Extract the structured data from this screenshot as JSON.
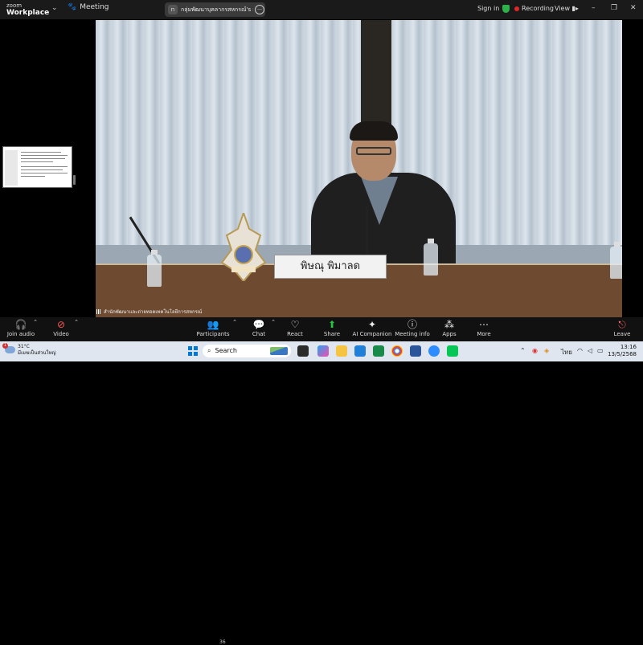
{
  "app": {
    "brand_line1": "zoom",
    "brand_line2": "Workplace",
    "meeting_label": "Meeting"
  },
  "share_pill": {
    "initial": "n",
    "text": "กลุ่มพัฒนาบุคลากรสหกรณ์'s screen"
  },
  "topbar": {
    "sign_in": "Sign in",
    "recording": "Recording",
    "view": "View",
    "min": "–",
    "restore": "❐",
    "close": "✕"
  },
  "video": {
    "nameplate": "พิษณุ พิมาลด",
    "watermark": "สำนักพัฒนาและถ่ายทอดเทคโนโลยีการสหกรณ์"
  },
  "toolbar": {
    "join_audio": "Join audio",
    "video": "Video",
    "participants": "Participants",
    "participants_count": "36",
    "chat": "Chat",
    "react": "React",
    "share": "Share",
    "ai_companion": "AI Companion",
    "meeting_info": "Meeting info",
    "apps": "Apps",
    "more": "More",
    "leave": "Leave"
  },
  "taskbar": {
    "weather_temp": "31°C",
    "weather_desc": "มีเมฆเป็นส่วนใหญ่",
    "weather_badge": "1",
    "search": "Search",
    "lang": "ไทย",
    "time": "13:16",
    "date": "13/5/2568"
  },
  "colors": {
    "toolbar_bg": "#111111",
    "share_green": "#27c442",
    "recording_red": "#e02828",
    "taskbar_bg": "#dfe6f0"
  }
}
